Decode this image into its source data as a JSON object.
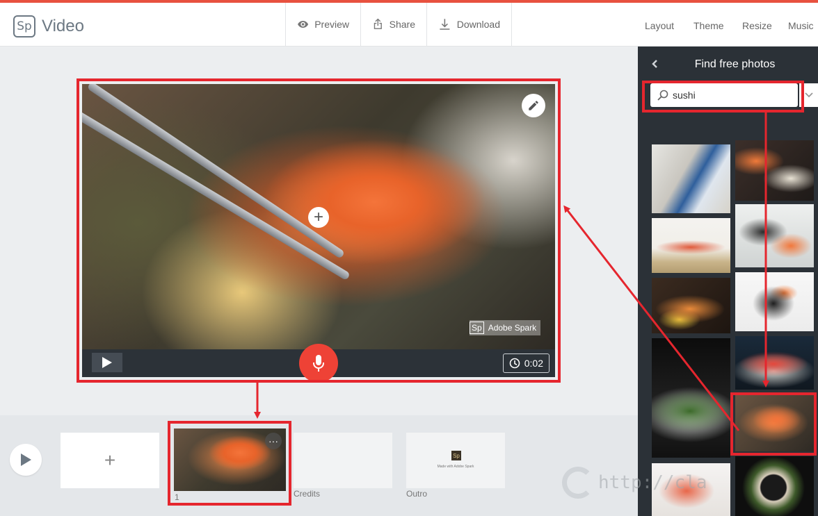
{
  "app": {
    "logo_mark": "Sp",
    "title": "Video"
  },
  "toolbar": {
    "preview": "Preview",
    "share": "Share",
    "download": "Download"
  },
  "menu": [
    "Layout",
    "Theme",
    "Resize",
    "Music"
  ],
  "player": {
    "watermark_mark": "Sp",
    "watermark_text": "Adobe Spark",
    "duration": "0:02",
    "add_symbol": "+"
  },
  "filmstrip": {
    "add_symbol": "+",
    "slides": [
      {
        "label": "1"
      },
      {
        "label": "Credits"
      },
      {
        "label": "Outro",
        "mark": "Sp",
        "caption": "Made with Adobe Spark"
      }
    ],
    "more_symbol": "···"
  },
  "panel": {
    "title": "Find free photos",
    "search_value": "sushi"
  },
  "site_watermark": "http://cla",
  "colors": {
    "accent_red": "#e8513f",
    "annotation_red": "#e5262e",
    "mic_red": "#ee4236",
    "panel_bg": "#2b3137"
  }
}
